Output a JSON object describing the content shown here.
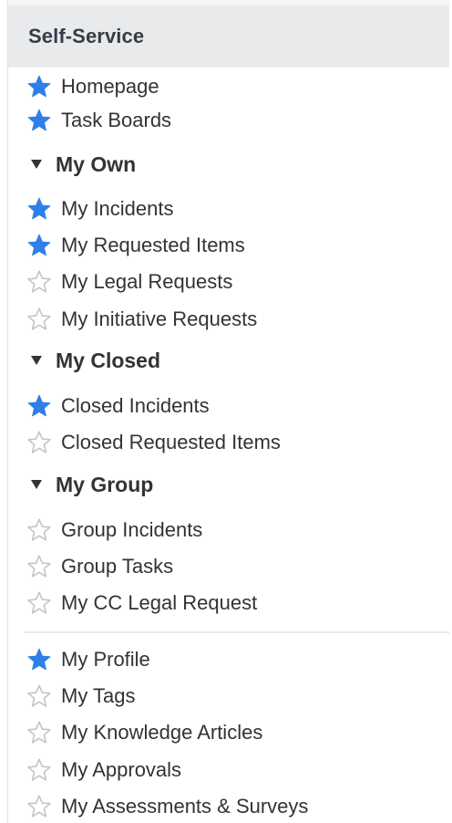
{
  "panel": {
    "title": "Self-Service"
  },
  "items": [
    {
      "label": "Homepage",
      "favorite": true,
      "icon": "star-filled-icon"
    },
    {
      "label": "Task Boards",
      "favorite": true,
      "icon": "star-filled-icon"
    }
  ],
  "sections": [
    {
      "label": "My Own",
      "expanded": true,
      "items": [
        {
          "label": "My Incidents",
          "favorite": true
        },
        {
          "label": "My Requested Items",
          "favorite": true
        },
        {
          "label": "My Legal Requests",
          "favorite": false
        },
        {
          "label": "My Initiative Requests",
          "favorite": false
        }
      ]
    },
    {
      "label": "My Closed",
      "expanded": true,
      "items": [
        {
          "label": "Closed Incidents",
          "favorite": true
        },
        {
          "label": "Closed Requested Items",
          "favorite": false
        }
      ]
    },
    {
      "label": "My Group",
      "expanded": true,
      "items": [
        {
          "label": "Group Incidents",
          "favorite": false
        },
        {
          "label": "Group Tasks",
          "favorite": false
        },
        {
          "label": "My CC Legal Request",
          "favorite": false
        }
      ]
    }
  ],
  "bottom_items": [
    {
      "label": "My Profile",
      "favorite": true
    },
    {
      "label": "My Tags",
      "favorite": false
    },
    {
      "label": "My Knowledge Articles",
      "favorite": false
    },
    {
      "label": "My Approvals",
      "favorite": false
    },
    {
      "label": "My Assessments & Surveys",
      "favorite": false
    }
  ],
  "colors": {
    "star_filled": "#2f7fe8",
    "star_outline": "#c4c4c4",
    "header_bg": "#e9eaec"
  }
}
